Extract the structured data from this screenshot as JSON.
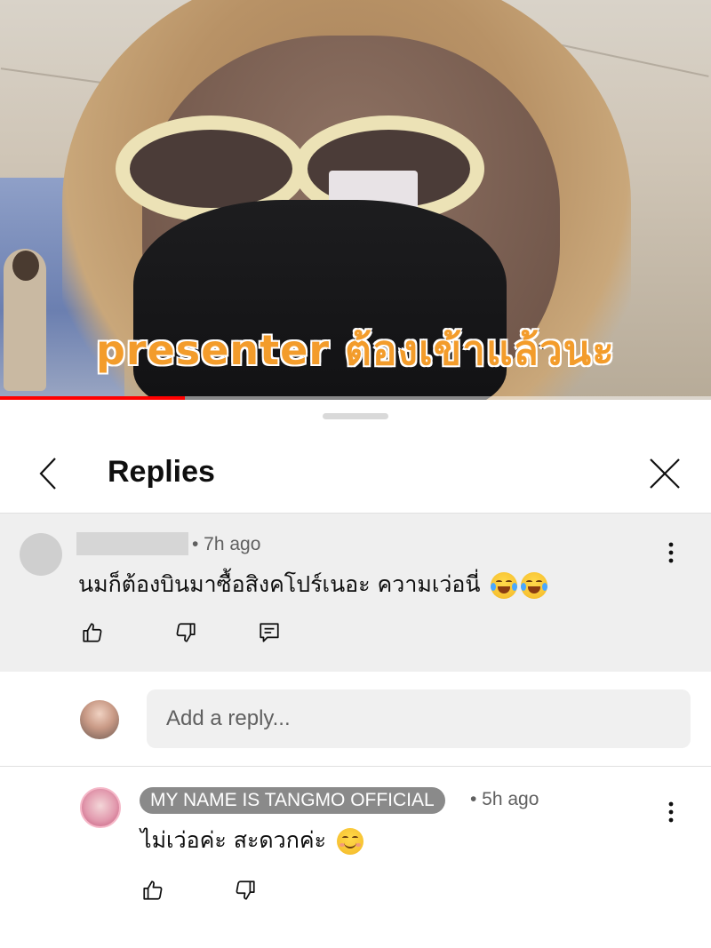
{
  "video": {
    "caption": "presenter ต้องเข้าแล้วนะ",
    "progress_percent": 26
  },
  "sheet": {
    "title": "Replies"
  },
  "parent_comment": {
    "time": "• 7h ago",
    "text": "นมก็ต้องบินมาซื้อสิงคโปร์เนอะ ความเว่อนี่",
    "emojis": [
      "face-with-tears-of-joy",
      "face-with-tears-of-joy"
    ]
  },
  "composer": {
    "placeholder": "Add a reply..."
  },
  "reply": {
    "author": "MY NAME IS TANGMO OFFICIAL",
    "time": "• 5h ago",
    "text": "ไม่เว่อค่ะ สะดวกค่ะ",
    "emojis": [
      "smiling-face-with-smiling-eyes"
    ]
  },
  "colors": {
    "progress": "#ff0000",
    "parent_bg": "#efefef",
    "badge_bg": "#8a8a8a"
  }
}
